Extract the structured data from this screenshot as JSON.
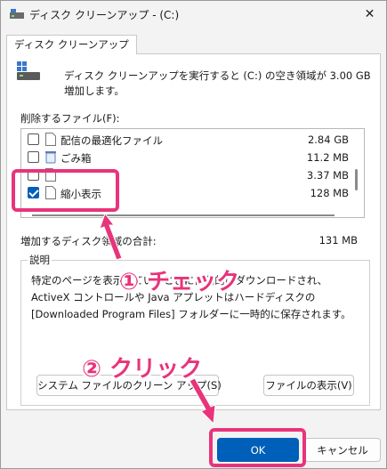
{
  "window": {
    "title": "ディスク クリーンアップ - (C:)",
    "close_glyph": "✕"
  },
  "tab": {
    "label": "ディスク クリーンアップ"
  },
  "intro": {
    "text": "ディスク クリーンアップを実行すると (C:) の空き領域が 3.00 GB 増加します。"
  },
  "files": {
    "label": "削除するファイル(F):",
    "items": [
      {
        "name": "配信の最適化ファイル",
        "size": "2.84 GB",
        "checked": false
      },
      {
        "name": "ごみ箱",
        "size": "11.2 MB",
        "checked": false
      },
      {
        "name": "",
        "size": "3.37 MB",
        "checked": false
      },
      {
        "name": "縮小表示",
        "size": "128 MB",
        "checked": true
      }
    ]
  },
  "total": {
    "label": "増加するディスク領域の合計:",
    "value": "131 MB"
  },
  "description": {
    "label": "説明",
    "lines": [
      "特定のページを表示しているときに自動的にダウンロードされ、",
      "ActiveX コントロールや Java アプレットはハードディスクの",
      "[Downloaded Program Files] フォルダーに一時的に保存されます。"
    ]
  },
  "buttons": {
    "cleanup_system": "システム ファイルのクリーン アップ(S)",
    "show_files": "ファイルの表示(V)",
    "ok": "OK",
    "cancel": "キャンセル"
  },
  "annotations": {
    "step1": "① チェック",
    "step2": "② クリック",
    "color": "#e8347a"
  },
  "colors": {
    "accent": "#005fb8"
  }
}
